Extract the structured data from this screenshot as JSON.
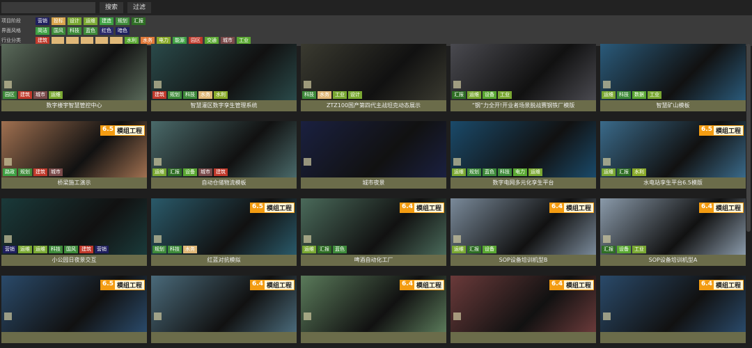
{
  "toolbar": {
    "search_placeholder": "",
    "search_label": "搜索",
    "filter_label": "过滤"
  },
  "filters": [
    {
      "label": "项目阶段",
      "tags": [
        {
          "t": "营销",
          "c": "#1f1f5e"
        },
        {
          "t": "投标",
          "c": "#d9a44a"
        },
        {
          "t": "设计",
          "c": "#7aa832"
        },
        {
          "t": "运维",
          "c": "#7aa832"
        },
        {
          "t": "建造",
          "c": "#3ea043"
        },
        {
          "t": "规划",
          "c": "#3e8a3a"
        },
        {
          "t": "汇报",
          "c": "#2e6e24"
        }
      ]
    },
    {
      "label": "界面风格",
      "tags": [
        {
          "t": "简洁",
          "c": "#3ea043"
        },
        {
          "t": "国风",
          "c": "#3e8a3a"
        },
        {
          "t": "科技",
          "c": "#3e8a3a"
        },
        {
          "t": "蓝色",
          "c": "#3e8a3a"
        },
        {
          "t": "红色",
          "c": "#2a2a6a"
        },
        {
          "t": "暗色",
          "c": "#1f1f5e"
        }
      ]
    },
    {
      "label": "行业分类",
      "tags": [
        {
          "t": "建筑",
          "c": "#c0392b"
        },
        {
          "t": "",
          "c": "#e0b878"
        },
        {
          "t": "",
          "c": "#e0b878"
        },
        {
          "t": "",
          "c": "#e0b878"
        },
        {
          "t": "",
          "c": "#e0b878"
        },
        {
          "t": "",
          "c": "#e0b878"
        },
        {
          "t": "水利",
          "c": "#5aa832"
        },
        {
          "t": "水务",
          "c": "#e07a3a"
        },
        {
          "t": "电力",
          "c": "#8aaa2a"
        },
        {
          "t": "能源",
          "c": "#3ea043"
        },
        {
          "t": "园区",
          "c": "#c0392b"
        },
        {
          "t": "交通",
          "c": "#5aa832"
        },
        {
          "t": "城市",
          "c": "#7a4a4a"
        },
        {
          "t": "工业",
          "c": "#5aa832"
        }
      ]
    }
  ],
  "cards": [
    {
      "title": "数字楼宇智慧管控中心",
      "badge": null,
      "tags": [
        "园区",
        "建筑",
        "城市",
        "运维"
      ],
      "bg": "#5a6a5a"
    },
    {
      "title": "智慧灌区数字孪生管理系统",
      "badge": null,
      "tags": [
        "建筑",
        "规划",
        "科技",
        "水务",
        "水利"
      ],
      "bg": "#2a4a4a"
    },
    {
      "title": "ZTZ100国产第四代主战坦克动态展示",
      "badge": null,
      "tags": [
        "科技",
        "水务",
        "工业",
        "设计"
      ],
      "bg": "#3a3a30"
    },
    {
      "title": "“钢”力全开!开业者场景脱战赛钢铁厂模版",
      "badge": null,
      "tags": [
        "汇报",
        "运维",
        "设备",
        "工业"
      ],
      "bg": "#4a4a50"
    },
    {
      "title": "智慧矿山模板",
      "badge": null,
      "tags": [
        "运维",
        "科技",
        "数据",
        "工业"
      ],
      "bg": "#2a5a7a"
    },
    {
      "title": "桥梁施工演示",
      "badge": "6.5",
      "tags": [
        "路政",
        "规划",
        "建筑",
        "城市"
      ],
      "bg": "#a07050"
    },
    {
      "title": "自动仓储物流模板",
      "badge": null,
      "tags": [
        "运维",
        "汇报",
        "设备",
        "城市",
        "建筑"
      ],
      "bg": "#4a6a6a"
    },
    {
      "title": "城市夜景",
      "badge": null,
      "tags": [],
      "bg": "#1a2040"
    },
    {
      "title": "数字电网多元化孪生平台",
      "badge": null,
      "tags": [
        "运维",
        "规划",
        "蓝色",
        "科技",
        "电力",
        "运维"
      ],
      "bg": "#1a4a6a"
    },
    {
      "title": "水电站孪生平台6.5模版",
      "badge": "6.5",
      "tags": [
        "运维",
        "汇报",
        "水利"
      ],
      "bg": "#3a6a8a"
    },
    {
      "title": "小公园日夜景交互",
      "badge": null,
      "tags": [
        "营销",
        "运维",
        "运维",
        "科技",
        "国风",
        "建筑",
        "营销"
      ],
      "bg": "#1a3a3a"
    },
    {
      "title": "红蓝对抗模拟",
      "badge": "6.5",
      "tags": [
        "规划",
        "科技",
        "水务"
      ],
      "bg": "#2a5a6a"
    },
    {
      "title": "啤酒自动化工厂",
      "badge": "6.4",
      "tags": [
        "运维",
        "汇报",
        "蓝色"
      ],
      "bg": "#4a6a5a"
    },
    {
      "title": "SOP设备培训机型B",
      "badge": "6.4",
      "tags": [
        "运维",
        "汇报",
        "设备"
      ],
      "bg": "#7a8a9a"
    },
    {
      "title": "SOP设备培训机型A",
      "badge": "6.4",
      "tags": [
        "汇报",
        "设备",
        "工业"
      ],
      "bg": "#8a9aaa"
    },
    {
      "title": "",
      "badge": "6.5",
      "tags": [],
      "bg": "#2a4a6a"
    },
    {
      "title": "",
      "badge": "6.4",
      "tags": [],
      "bg": "#4a6a7a"
    },
    {
      "title": "",
      "badge": "6.4",
      "tags": [],
      "bg": "#5a7a5a"
    },
    {
      "title": "",
      "badge": "6.4",
      "tags": [],
      "bg": "#6a3a3a"
    },
    {
      "title": "",
      "badge": "6.4",
      "tags": [],
      "bg": "#2a4a6a"
    }
  ],
  "badge_text": "模组工程",
  "tag_colors": {
    "运维": "#7aa832",
    "汇报": "#2e6e24",
    "建筑": "#c0392b",
    "城市": "#7a4a4a",
    "园区": "#3e8a3a",
    "规划": "#3e8a3a",
    "科技": "#3e8a3a",
    "水务": "#e0b878",
    "水利": "#8aaa2a",
    "工业": "#7aa832",
    "设计": "#7aa832",
    "设备": "#5aa832",
    "数据": "#5aa832",
    "路政": "#3ea043",
    "蓝色": "#3e8a3a",
    "电力": "#5aa832",
    "营销": "#1f1f5e",
    "国风": "#3e8a3a"
  }
}
